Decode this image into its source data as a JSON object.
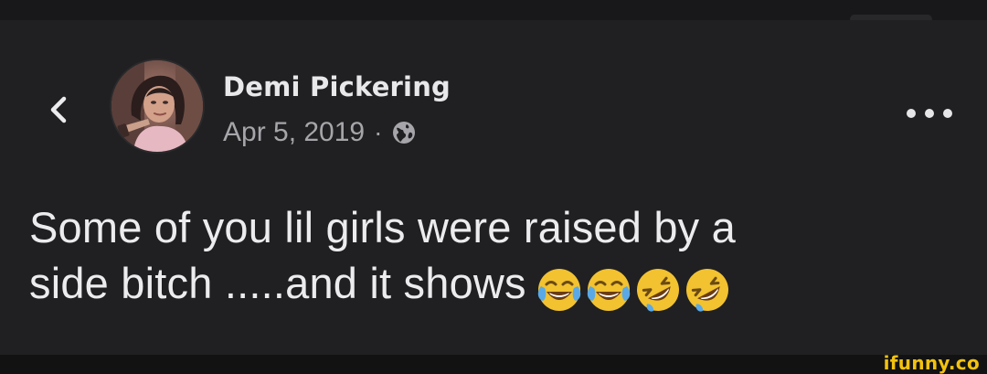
{
  "post": {
    "author": "Demi Pickering",
    "date": "Apr 5, 2019",
    "separator": "·",
    "text_line1": "Some of you lil girls were raised by a",
    "text_line2": "side bitch .....and it shows",
    "emojis": [
      "face-with-tears-of-joy",
      "face-with-tears-of-joy",
      "rolling-on-the-floor-laughing",
      "rolling-on-the-floor-laughing"
    ]
  },
  "icons": {
    "back": "chevron-left-icon",
    "privacy": "globe-icon",
    "more": "more-horizontal-icon"
  },
  "watermark": "ifunny.co",
  "colors": {
    "background": "#202022",
    "text": "#ececee",
    "meta": "#a6a6aa",
    "watermark": "#f3c20f",
    "emoji": "#f2c230"
  }
}
